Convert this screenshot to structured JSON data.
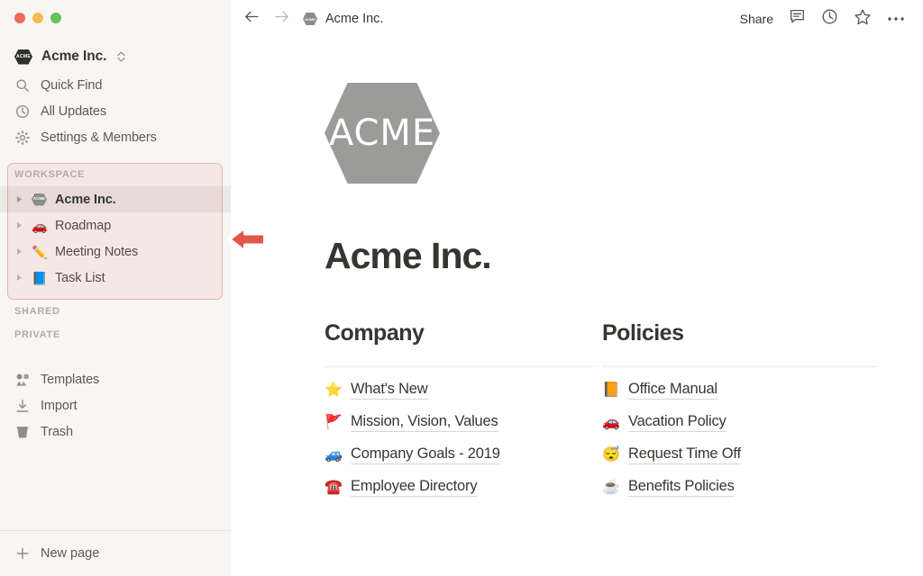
{
  "window": {
    "traffic_lights": [
      {
        "name": "close",
        "color": "#ED6A5E"
      },
      {
        "name": "minimize",
        "color": "#F5BD4F"
      },
      {
        "name": "maximize",
        "color": "#61C454"
      }
    ]
  },
  "sidebar": {
    "workspace_switcher": {
      "label": "Acme Inc.",
      "badge_text": "ACME"
    },
    "nav": [
      {
        "label": "Quick Find",
        "icon": "search-icon"
      },
      {
        "label": "All Updates",
        "icon": "clock-icon"
      },
      {
        "label": "Settings & Members",
        "icon": "gear-icon"
      }
    ],
    "sections": [
      {
        "label": "WORKSPACE",
        "highlighted": true
      },
      {
        "label": "SHARED",
        "highlighted": false
      },
      {
        "label": "PRIVATE",
        "highlighted": false
      }
    ],
    "workspace_pages": [
      {
        "label": "Acme Inc.",
        "emoji": "",
        "icon": "acme-hex-icon",
        "active": true
      },
      {
        "label": "Roadmap",
        "emoji": "🚗",
        "icon": "car-emoji",
        "active": false
      },
      {
        "label": "Meeting Notes",
        "emoji": "✏️",
        "icon": "pencil-emoji",
        "active": false
      },
      {
        "label": "Task List",
        "emoji": "📘",
        "icon": "blue-book-emoji",
        "active": false
      }
    ],
    "utility": [
      {
        "label": "Templates",
        "icon": "templates-icon"
      },
      {
        "label": "Import",
        "icon": "import-icon"
      },
      {
        "label": "Trash",
        "icon": "trash-icon"
      }
    ],
    "new_page": {
      "label": "New page",
      "icon": "plus-icon"
    },
    "highlight_color": "#DE6E68"
  },
  "topbar": {
    "back_icon": "arrow-left-icon",
    "forward_icon": "arrow-right-icon",
    "breadcrumb": {
      "label": "Acme Inc.",
      "badge_text": "ACME"
    },
    "share_label": "Share",
    "icons": [
      "comment-icon",
      "clock-icon",
      "star-icon",
      "more-icon"
    ]
  },
  "annotation": {
    "arrow": "red-left-arrow",
    "color": "#E2574C"
  },
  "document": {
    "logo_text": "ACME",
    "title": "Acme Inc.",
    "columns": [
      {
        "heading": "Company",
        "links": [
          {
            "emoji": "⭐",
            "label": "What's New",
            "icon": "star-emoji"
          },
          {
            "emoji": "🚩",
            "label": "Mission, Vision, Values",
            "icon": "triangular-flag-emoji"
          },
          {
            "emoji": "🚙",
            "label": "Company Goals - 2019",
            "icon": "blue-car-emoji"
          },
          {
            "emoji": "☎️",
            "label": "Employee Directory",
            "icon": "telephone-emoji"
          }
        ]
      },
      {
        "heading": "Policies",
        "links": [
          {
            "emoji": "📙",
            "label": "Office Manual",
            "icon": "orange-book-emoji"
          },
          {
            "emoji": "🚗",
            "label": "Vacation Policy",
            "icon": "red-car-emoji"
          },
          {
            "emoji": "😴",
            "label": "Request Time Off",
            "icon": "sleeping-face-emoji"
          },
          {
            "emoji": "☕",
            "label": "Benefits Policies",
            "icon": "coffee-emoji"
          }
        ]
      }
    ]
  }
}
